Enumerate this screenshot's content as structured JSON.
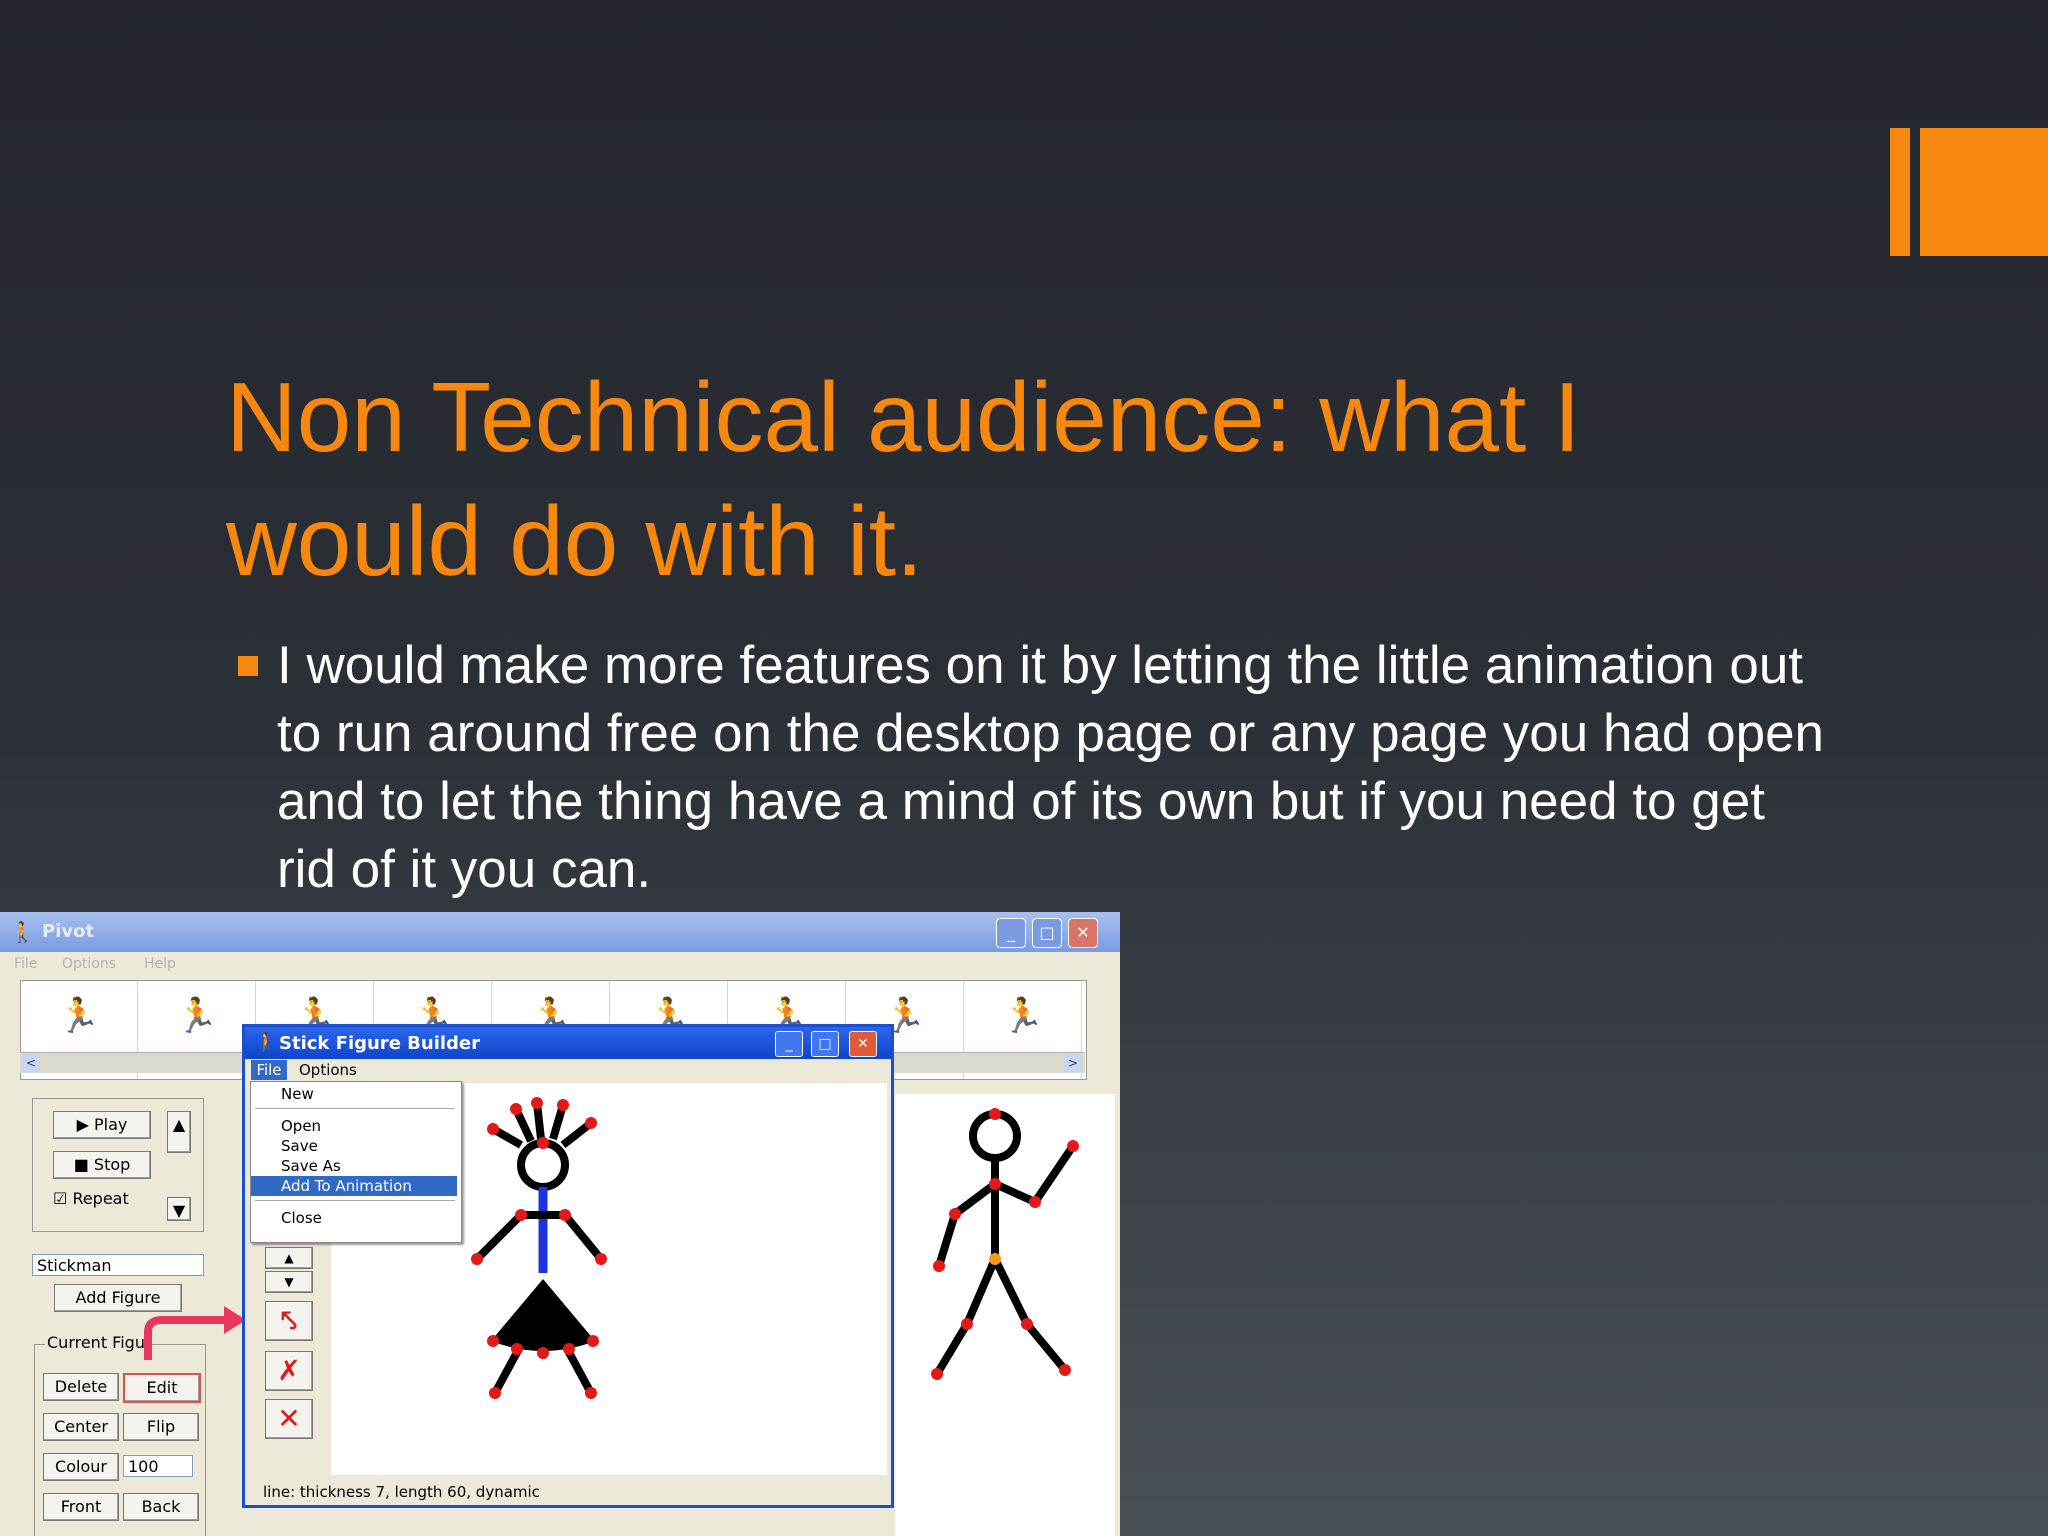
{
  "slide": {
    "title": "Non Technical audience: what I would do with it.",
    "bullet_text": "I would make more features on it by letting the little animation out to run around free on the desktop page or any page you had open and to let the thing have a mind of its own but if you need to get rid of it you can.",
    "accent_color": "#f7880f"
  },
  "pivot": {
    "title": "Pivot",
    "menu": [
      "File",
      "Options",
      "Help"
    ],
    "window_buttons": [
      "minimize-icon",
      "maximize-icon",
      "close-icon"
    ],
    "controls": {
      "play": "Play",
      "stop": "Stop",
      "repeat": "Repeat",
      "repeat_checked": true,
      "figure_select": "Stickman",
      "add_figure": "Add Figure",
      "current_figure_group": "Current Figu",
      "delete": "Delete",
      "edit": "Edit",
      "center": "Center",
      "flip": "Flip",
      "colour": "Colour",
      "colour_value": "100",
      "front": "Front",
      "back": "Back"
    }
  },
  "builder": {
    "title": "Stick Figure Builder",
    "menu": [
      "File",
      "Options"
    ],
    "file_menu": {
      "items": [
        "New",
        "Open",
        "Save",
        "Save As",
        "Add To Animation",
        "Close"
      ],
      "selected": "Add To Animation"
    },
    "status": "line: thickness 7, length 60, dynamic"
  }
}
